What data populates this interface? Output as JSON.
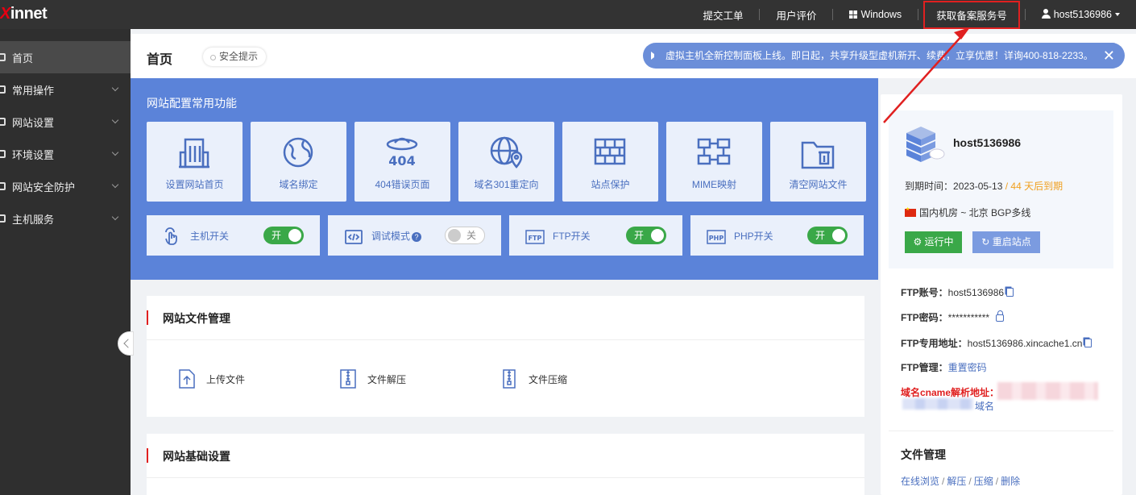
{
  "topbar": {
    "logo": "innet",
    "logo_prefix": "X",
    "nav": {
      "ticket": "提交工单",
      "review": "用户评价",
      "windows": "Windows",
      "icp": "获取备案服务号",
      "user": "host5136986"
    }
  },
  "sidebar": {
    "items": [
      {
        "label": "首页",
        "icon": "home-icon"
      },
      {
        "label": "常用操作",
        "icon": "gear-icon"
      },
      {
        "label": "网站设置",
        "icon": "website-icon"
      },
      {
        "label": "环境设置",
        "icon": "environment-icon"
      },
      {
        "label": "网站安全防护",
        "icon": "shield-icon"
      },
      {
        "label": "主机服务",
        "icon": "server-icon"
      }
    ]
  },
  "header": {
    "title": "首页",
    "safety_tip": "安全提示",
    "notice": "虚拟主机全新控制面板上线。即日起，共享升级型虚机新开、续费，立享优惠！详询400-818-2233。",
    "notice_close": "✕"
  },
  "config": {
    "title": "网站配置常用功能",
    "tiles": [
      {
        "label": "设置网站首页",
        "icon": "building-icon"
      },
      {
        "label": "域名绑定",
        "icon": "globe-icon"
      },
      {
        "label": "404错误页面",
        "icon": "error-404-icon"
      },
      {
        "label": "域名301重定向",
        "icon": "globe-pin-icon"
      },
      {
        "label": "站点保护",
        "icon": "brick-wall-icon"
      },
      {
        "label": "MIME映射",
        "icon": "network-icon"
      },
      {
        "label": "清空网站文件",
        "icon": "folder-clear-icon"
      }
    ],
    "switches": [
      {
        "label": "主机开关",
        "state": "开",
        "on": true,
        "icon": "hand-icon"
      },
      {
        "label": "调试模式",
        "state": "关",
        "on": false,
        "icon": "code-icon",
        "help": "?"
      },
      {
        "label": "FTP开关",
        "state": "开",
        "on": true,
        "icon": "ftp-icon"
      },
      {
        "label": "PHP开关",
        "state": "开",
        "on": true,
        "icon": "php-icon"
      }
    ]
  },
  "file_mgmt": {
    "title": "网站文件管理",
    "actions": [
      {
        "label": "上传文件",
        "icon": "upload-file-icon"
      },
      {
        "label": "文件解压",
        "icon": "unzip-icon"
      },
      {
        "label": "文件压缩",
        "icon": "zip-icon"
      }
    ]
  },
  "basic_settings": {
    "title": "网站基础设置"
  },
  "host": {
    "name": "host5136986",
    "expire_label": "到期时间：",
    "expire_date": "2023-05-13",
    "expire_sep": " / ",
    "expire_warn": "44 天后到期",
    "room": "国内机房 ~ 北京 BGP多线",
    "run_btn": "运行中",
    "restart_btn": "重启站点",
    "ftp_account_label": "FTP账号：",
    "ftp_account": "host5136986",
    "ftp_password_label": "FTP密码：",
    "ftp_password": "***********",
    "ftp_address_label": "FTP专用地址：",
    "ftp_address": "host5136986.xincache1.cn",
    "ftp_manage_label": "FTP管理：",
    "ftp_manage_link": "重置密码",
    "cname_label": "域名cname解析地址：",
    "cname_suffix": "域名",
    "file_manage_title": "文件管理",
    "file_links": [
      "在线浏览",
      "解压",
      "压缩",
      "删除"
    ],
    "file_link_sep": "/"
  },
  "colors": {
    "accent": "#5b83d9",
    "topbar": "#333333",
    "sidebar": "#2f2f2f",
    "on": "#3aa848",
    "warn": "#f0a020",
    "highlight": "#e02020"
  }
}
